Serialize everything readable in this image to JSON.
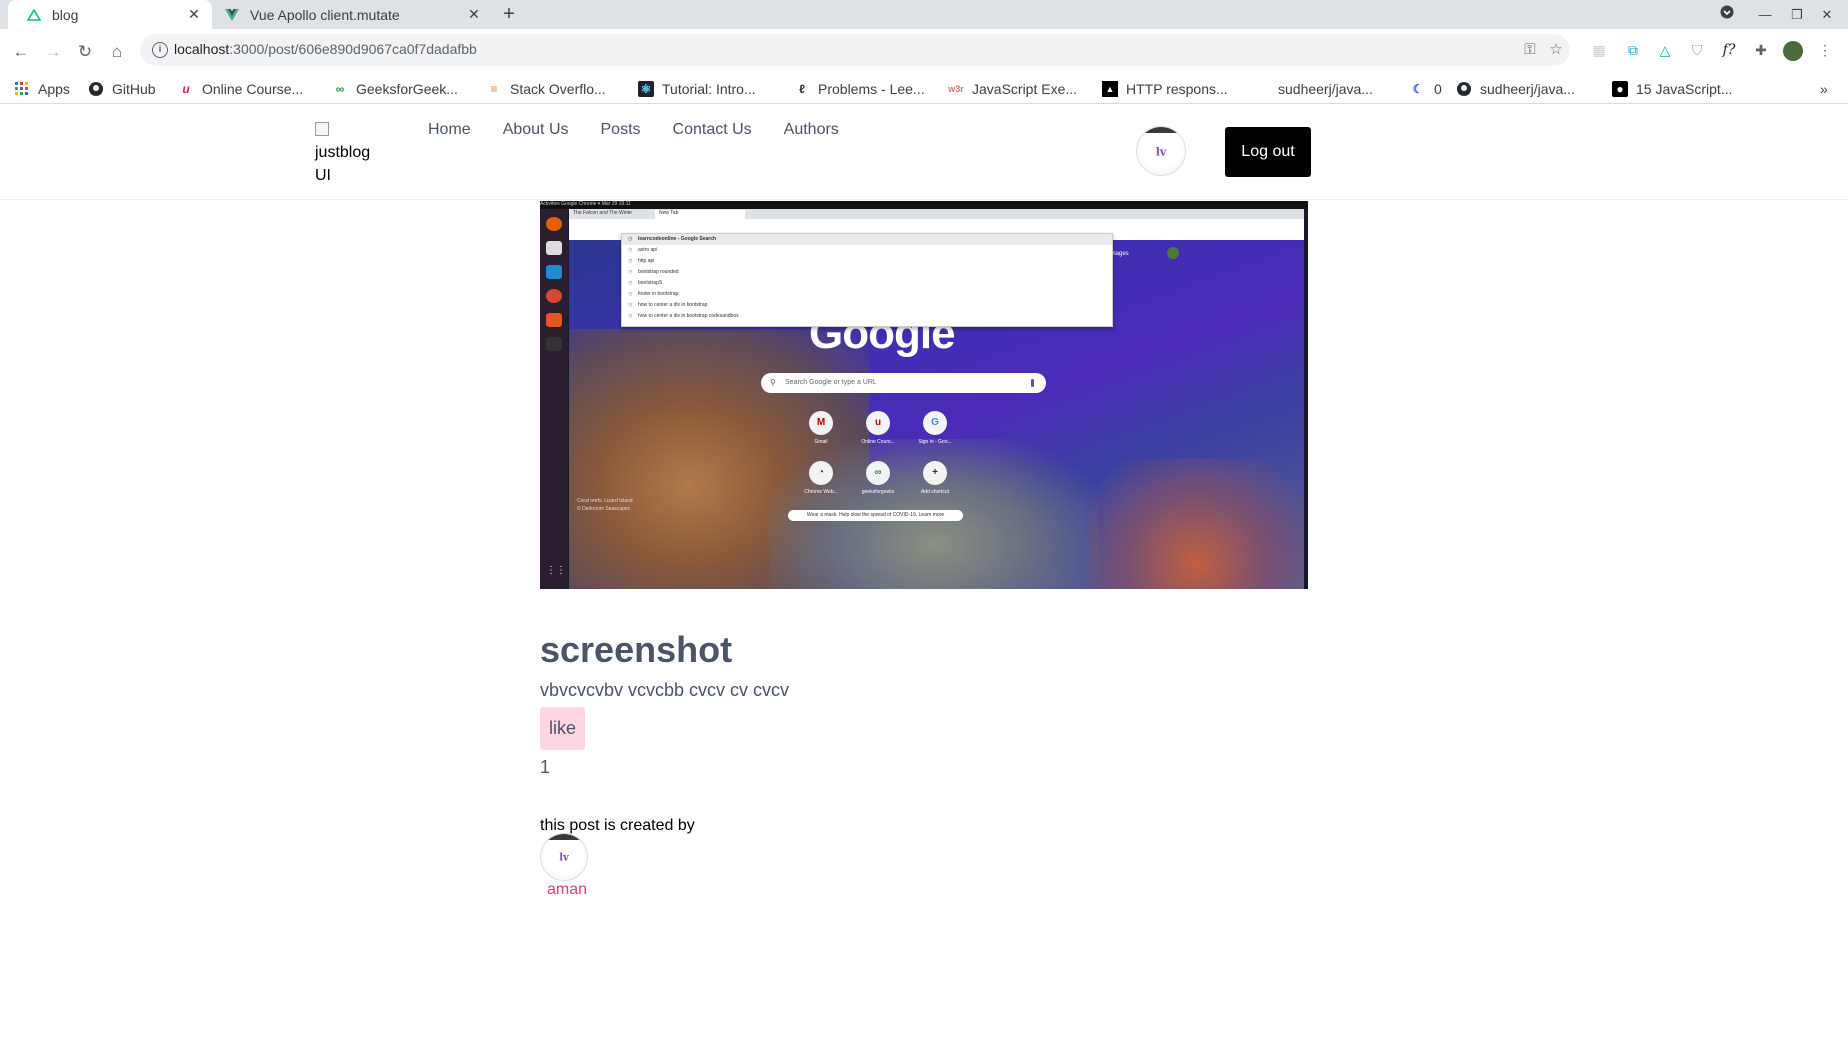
{
  "browser": {
    "tabs": [
      {
        "title": "blog",
        "close": "✕"
      },
      {
        "title": "Vue Apollo client.mutate",
        "close": "✕"
      }
    ],
    "new_tab": "+",
    "url_host": "localhost",
    "url_rest": ":3000/post/606e890d9067ca0f7dadafbb",
    "bookmarks": [
      "Apps",
      "GitHub",
      "Online Course...",
      "GeeksforGeek...",
      "Stack Overflo...",
      "Tutorial: Intro...",
      "Problems - Lee...",
      "JavaScript Exe...",
      "HTTP respons...",
      "sudheerj/java...",
      "0",
      "sudheerj/java...",
      "15 JavaScript..."
    ],
    "bookmarks_more": "»"
  },
  "site": {
    "logo_alt": "justblog UI",
    "nav": [
      "Home",
      "About Us",
      "Posts",
      "Contact Us",
      "Authors"
    ],
    "logout_label": "Log out",
    "avatar_mark": "lv"
  },
  "image": {
    "tab1": "The Falcon and The Winte",
    "tab2": "New Tab",
    "dropdown": [
      "learncodeonline - Google Search",
      "astro api",
      "http api",
      "bootstrap rounded",
      "bootstrapS",
      "footer in bootstrap",
      "how to center a div in bootstrap",
      "how to center a div in bootstrap codesandbox"
    ],
    "google": "Google",
    "search_placeholder": "Search Google or type a URL",
    "shortcuts": [
      "Gmail",
      "Online Cours...",
      "Sign in - Goo...",
      "Chrome Web...",
      "geeksforgeeks",
      "Add shortcut"
    ],
    "mask_text": "Wear a mask. Help slow the spread of COVID-19. Learn more",
    "credit": "Coral reefs, Lizard Island",
    "credit2": "© Darkroom Seascapes",
    "images_link": "Images",
    "topbar": "Activities   Google Chrome ▾                                    Mar 29  19:11"
  },
  "post": {
    "title": "screenshot",
    "body": "vbvcvcvbv vcvcbb cvcv cv cvcv",
    "like_label": "like",
    "like_count": "1",
    "created_by": "this post is created by",
    "author": "aman"
  }
}
